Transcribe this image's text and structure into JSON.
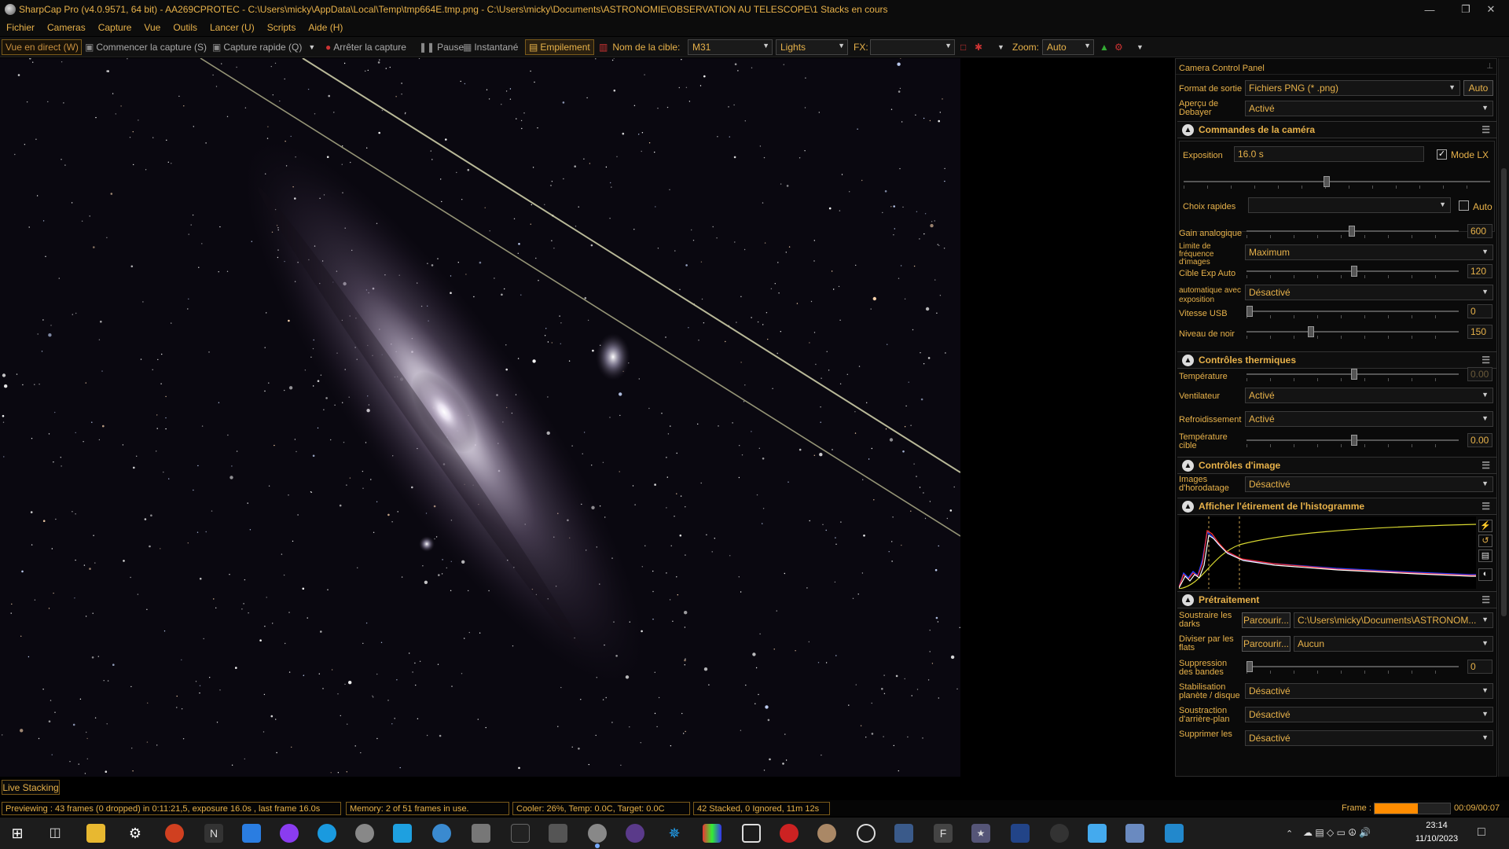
{
  "window": {
    "title": "SharpCap Pro (v4.0.9571, 64 bit) - AA269CPROTEC - C:\\Users\\micky\\AppData\\Local\\Temp\\tmp664E.tmp.png - C:\\Users\\micky\\Documents\\ASTRONOMIE\\OBSERVATION AU TELESCOPE\\1 Stacks en cours",
    "min_icon": "minimize-icon",
    "max_icon": "maximize-icon",
    "close_icon": "close-icon"
  },
  "menu": [
    "Fichier",
    "Cameras",
    "Capture",
    "Vue",
    "Outils",
    "Lancer (U)",
    "Scripts",
    "Aide (H)"
  ],
  "toolbar": {
    "live_view": "Vue en direct (W)",
    "start_capture": "Commencer la capture (S)",
    "quick_capture": "Capture rapide (Q)",
    "stop_capture": "Arrêter la capture",
    "pause": "Pause",
    "snapshot": "Instantané",
    "stacking": "Empilement",
    "target_label": "Nom de la cible:",
    "target_value": "M31",
    "frame_type": "Lights",
    "fx_label": "FX:",
    "fx_value": "",
    "zoom_label": "Zoom:",
    "zoom_value": "Auto"
  },
  "viewer": {
    "live_stacking": "Live Stacking"
  },
  "panel": {
    "title": "Camera Control Panel",
    "output_format_label": "Format de sortie",
    "output_format_value": "Fichiers PNG (* .png)",
    "output_auto": "Auto",
    "debayer_label": "Aperçu de Debayer",
    "debayer_value": "Activé",
    "camera_section": "Commandes de la caméra",
    "exposure_label": "Exposition",
    "exposure_value": "16.0 s",
    "lx_mode": "Mode LX",
    "lx_checked": true,
    "quick_choices_label": "Choix rapides",
    "quick_choices_value": "",
    "quick_auto": "Auto",
    "gain_label": "Gain analogique",
    "gain_value": "600",
    "framerate_label": "Limite de fréquence d'images",
    "framerate_value": "Maximum",
    "autoexp_target_label": "Cible Exp Auto",
    "autoexp_target_value": "120",
    "auto_with_exposure_label": "automatique avec exposition",
    "auto_with_exposure_value": "Désactivé",
    "usb_speed_label": "Vitesse USB",
    "usb_speed_value": "0",
    "black_level_label": "Niveau de noir",
    "black_level_value": "150",
    "thermal_section": "Contrôles thermiques",
    "temperature_label": "Température",
    "temperature_value": "0.00",
    "fan_label": "Ventilateur",
    "fan_value": "Activé",
    "cooling_label": "Refroidissement",
    "cooling_value": "Activé",
    "target_temp_label": "Température cible",
    "target_temp_value": "0.00",
    "image_section": "Contrôles d'image",
    "timestamp_label": "Images d'horodatage",
    "timestamp_value": "Désactivé",
    "histogram_section": "Afficher l'étirement de l'histogramme",
    "preprocessing_section": "Prétraitement",
    "darks_label": "Soustraire les darks",
    "browse": "Parcourir...",
    "darks_value": "C:\\Users\\micky\\Documents\\ASTRONOM...",
    "flats_label": "Diviser par les flats",
    "flats_value": "Aucun",
    "banding_label": "Suppression des bandes",
    "banding_value": "0",
    "stabilize_label": "Stabilisation planète / disque",
    "stabilize_value": "Désactivé",
    "background_label": "Soustraction d'arrière-plan",
    "background_value": "Désactivé",
    "remove_label": "Supprimer les",
    "remove_value": "Désactivé"
  },
  "status": {
    "previewing": "Previewing : 43 frames (0 dropped) in 0:11:21,5, exposure 16.0s , last frame 16.0s",
    "memory": "Memory: 2 of 51 frames in use.",
    "cooler": "Cooler: 26%, Temp: 0.0C, Target: 0.0C",
    "stacked": "42 Stacked, 0 Ignored, 11m 12s",
    "frame_label": "Frame :",
    "frame_time": "00:09/00:07",
    "frame_progress": 0.57
  },
  "taskbar": {
    "time": "23:14",
    "date": "11/10/2023"
  },
  "colors": {
    "accent": "#e8b24a",
    "stacking_active": "#e8b24a",
    "progress": "#ff8c00"
  }
}
